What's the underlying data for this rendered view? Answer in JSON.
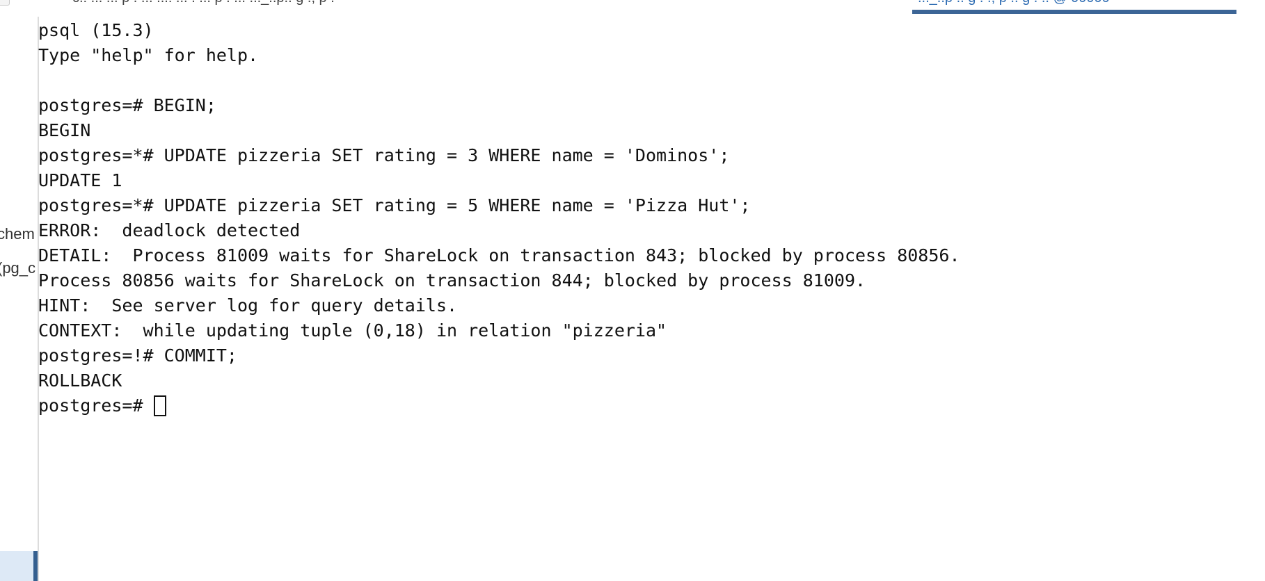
{
  "header": {
    "tab_left_fragment": "c.: ... ... p . ... ...: ... . ... p . ... ..._..p.. g ., p .",
    "active_tab_fragment": "..._..p .. g . ., p .. g . .. @ 99999"
  },
  "sidebar": {
    "items": [
      {
        "label": "chem"
      },
      {
        "label": "(pg_c"
      }
    ]
  },
  "terminal": {
    "lines": [
      {
        "text": "psql (15.3)"
      },
      {
        "text": "Type \"help\" for help."
      },
      {
        "text": ""
      },
      {
        "text": "postgres=# BEGIN;"
      },
      {
        "text": "BEGIN"
      },
      {
        "text": "postgres=*# UPDATE pizzeria SET rating = 3 WHERE name = 'Dominos';"
      },
      {
        "text": "UPDATE 1"
      },
      {
        "text": "postgres=*# UPDATE pizzeria SET rating = 5 WHERE name = 'Pizza Hut';"
      },
      {
        "text": "ERROR:  deadlock detected"
      },
      {
        "text": "DETAIL:  Process 81009 waits for ShareLock on transaction 843; blocked by process 80856."
      },
      {
        "text": "Process 80856 waits for ShareLock on transaction 844; blocked by process 81009."
      },
      {
        "text": "HINT:  See server log for query details."
      },
      {
        "text": "CONTEXT:  while updating tuple (0,18) in relation \"pizzeria\""
      },
      {
        "text": "postgres=!# COMMIT;"
      },
      {
        "text": "ROLLBACK"
      }
    ],
    "prompt": "postgres=# "
  },
  "colors": {
    "text": "#111111",
    "background": "#ffffff",
    "accent": "#3c6596"
  }
}
